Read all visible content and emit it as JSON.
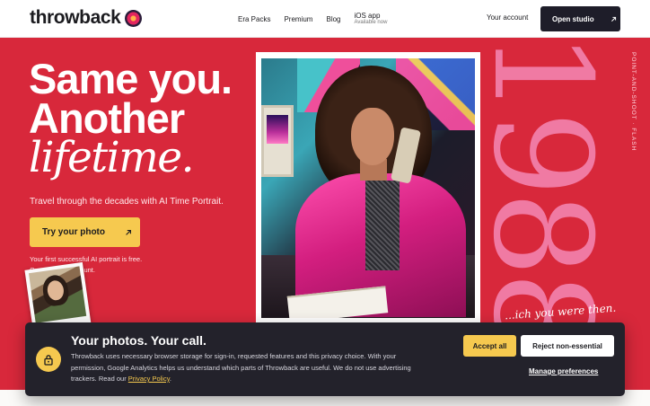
{
  "header": {
    "brand": "throwback",
    "nav": [
      "Era Packs",
      "Premium",
      "Blog"
    ],
    "ios_app": {
      "label": "iOS app",
      "sub": "Available now"
    },
    "account": "Your account",
    "cta": "Open studio",
    "cta_icon": "arrow-up-right-icon"
  },
  "hero": {
    "title_line1": "Same you.",
    "title_line2": "Another",
    "title_line3": "lifetime.",
    "subtitle": "Travel through the decades with AI Time Portrait.",
    "button": "Try your photo",
    "button_icon": "arrow-up-right-icon",
    "note_line1": "Your first successful AI portrait is free.",
    "note_line2": "One n... web account."
  },
  "side": {
    "year": "1988",
    "vertical_label": "POINT-AND-SHOOT · FLASH",
    "script": "...ich you were then."
  },
  "cookie": {
    "title": "Your photos. Your call.",
    "body": "Throwback uses necessary browser storage for sign-in, requested features and this privacy choice. With your permission, Google Analytics helps us understand which parts of Throwback are useful. We do not use advertising trackers. Read our ",
    "link": "Privacy Policy",
    "end": ".",
    "accept": "Accept all",
    "reject": "Reject non-essential",
    "manage": "Manage preferences",
    "icon": "lock-icon"
  },
  "colors": {
    "hero_red": "#d8283b",
    "accent_yellow": "#f6c94f",
    "year_pink": "#f07aa3",
    "dark": "#1e1d29"
  }
}
